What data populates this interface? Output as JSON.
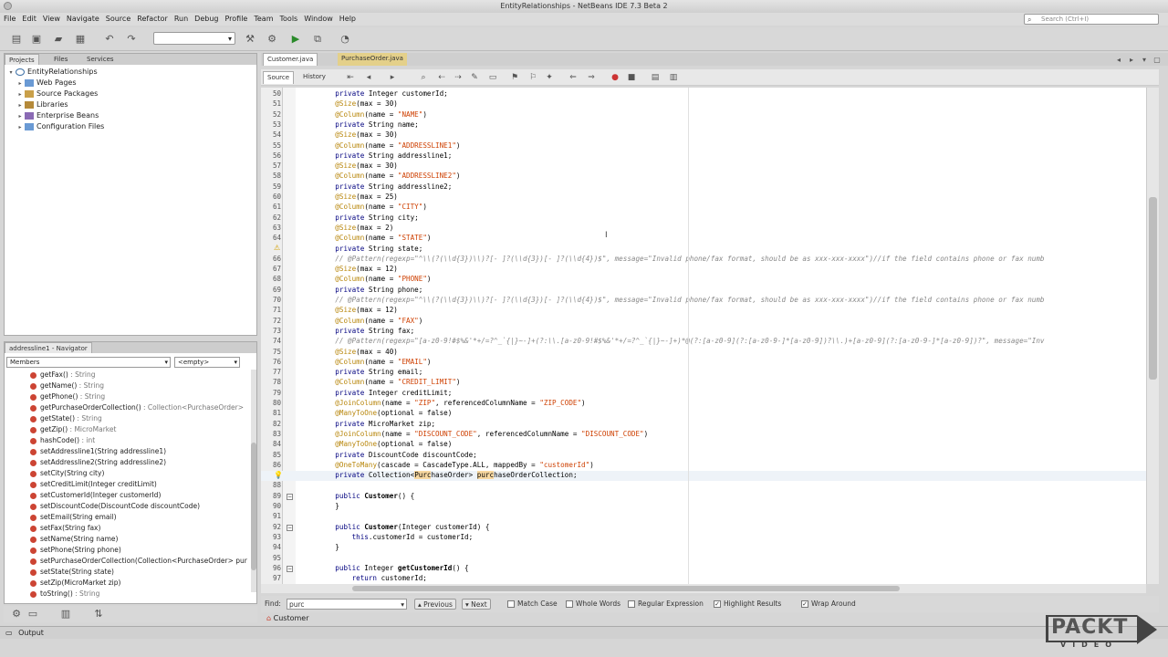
{
  "window": {
    "title": "EntityRelationships - NetBeans IDE 7.3 Beta 2"
  },
  "menu": [
    "File",
    "Edit",
    "View",
    "Navigate",
    "Source",
    "Refactor",
    "Run",
    "Debug",
    "Profile",
    "Team",
    "Tools",
    "Window",
    "Help"
  ],
  "search": {
    "placeholder": "Search (Ctrl+I)"
  },
  "projects": {
    "tabs": [
      "Projects",
      "Files",
      "Services"
    ],
    "root": "EntityRelationships",
    "items": [
      "Web Pages",
      "Source Packages",
      "Libraries",
      "Enterprise Beans",
      "Configuration Files"
    ]
  },
  "navigator": {
    "title": "addressline1 - Navigator",
    "filter": "Members",
    "scope": "<empty>",
    "items": [
      {
        "name": "getFax()",
        "ret": " : String"
      },
      {
        "name": "getName()",
        "ret": " : String"
      },
      {
        "name": "getPhone()",
        "ret": " : String"
      },
      {
        "name": "getPurchaseOrderCollection()",
        "ret": " : Collection<PurchaseOrder>"
      },
      {
        "name": "getState()",
        "ret": " : String"
      },
      {
        "name": "getZip()",
        "ret": " : MicroMarket"
      },
      {
        "name": "hashCode()",
        "ret": " : int"
      },
      {
        "name": "setAddressline1(String addressline1)",
        "ret": ""
      },
      {
        "name": "setAddressline2(String addressline2)",
        "ret": ""
      },
      {
        "name": "setCity(String city)",
        "ret": ""
      },
      {
        "name": "setCreditLimit(Integer creditLimit)",
        "ret": ""
      },
      {
        "name": "setCustomerId(Integer customerId)",
        "ret": ""
      },
      {
        "name": "setDiscountCode(DiscountCode discountCode)",
        "ret": ""
      },
      {
        "name": "setEmail(String email)",
        "ret": ""
      },
      {
        "name": "setFax(String fax)",
        "ret": ""
      },
      {
        "name": "setName(String name)",
        "ret": ""
      },
      {
        "name": "setPhone(String phone)",
        "ret": ""
      },
      {
        "name": "setPurchaseOrderCollection(Collection<PurchaseOrder> pur",
        "ret": ""
      },
      {
        "name": "setState(String state)",
        "ret": ""
      },
      {
        "name": "setZip(MicroMarket zip)",
        "ret": ""
      },
      {
        "name": "toString()",
        "ret": " : String"
      }
    ]
  },
  "editor": {
    "tabs": [
      "Customer.java",
      "PurchaseOrder.java"
    ],
    "modes": [
      "Source",
      "History"
    ],
    "lines": [
      {
        "n": "50",
        "t": "    private Integer customerId;"
      },
      {
        "n": "51",
        "t": "    @Size(max = 30)"
      },
      {
        "n": "52",
        "t": "    @Column(name = \"NAME\")"
      },
      {
        "n": "53",
        "t": "    private String name;"
      },
      {
        "n": "54",
        "t": "    @Size(max = 30)"
      },
      {
        "n": "55",
        "t": "    @Column(name = \"ADDRESSLINE1\")"
      },
      {
        "n": "56",
        "t": "    private String addressline1;"
      },
      {
        "n": "57",
        "t": "    @Size(max = 30)"
      },
      {
        "n": "58",
        "t": "    @Column(name = \"ADDRESSLINE2\")"
      },
      {
        "n": "59",
        "t": "    private String addressline2;"
      },
      {
        "n": "60",
        "t": "    @Size(max = 25)"
      },
      {
        "n": "61",
        "t": "    @Column(name = \"CITY\")"
      },
      {
        "n": "62",
        "t": "    private String city;"
      },
      {
        "n": "63",
        "t": "    @Size(max = 2)"
      },
      {
        "n": "64",
        "t": "    @Column(name = \"STATE\")"
      },
      {
        "n": "",
        "t": "    private String state;"
      },
      {
        "n": "66",
        "t": "    // @Pattern(regexp=\"^\\\\(?(\\\\d{3})\\\\)?[- ]?(\\\\d{3})[- ]?(\\\\d{4})$\", message=\"Invalid phone/fax format, should be as xxx-xxx-xxxx\")//if the field contains phone or fax numb"
      },
      {
        "n": "67",
        "t": "    @Size(max = 12)"
      },
      {
        "n": "68",
        "t": "    @Column(name = \"PHONE\")"
      },
      {
        "n": "69",
        "t": "    private String phone;"
      },
      {
        "n": "70",
        "t": "    // @Pattern(regexp=\"^\\\\(?(\\\\d{3})\\\\)?[- ]?(\\\\d{3})[- ]?(\\\\d{4})$\", message=\"Invalid phone/fax format, should be as xxx-xxx-xxxx\")//if the field contains phone or fax numb"
      },
      {
        "n": "71",
        "t": "    @Size(max = 12)"
      },
      {
        "n": "72",
        "t": "    @Column(name = \"FAX\")"
      },
      {
        "n": "73",
        "t": "    private String fax;"
      },
      {
        "n": "74",
        "t": "    // @Pattern(regexp=\"[a-z0-9!#$%&'*+/=?^_`{|}~-]+(?:\\\\.[a-z0-9!#$%&'*+/=?^_`{|}~-]+)*@(?:[a-z0-9](?:[a-z0-9-]*[a-z0-9])?\\\\.)+[a-z0-9](?:[a-z0-9-]*[a-z0-9])?\", message=\"Inv"
      },
      {
        "n": "75",
        "t": "    @Size(max = 40)"
      },
      {
        "n": "76",
        "t": "    @Column(name = \"EMAIL\")"
      },
      {
        "n": "77",
        "t": "    private String email;"
      },
      {
        "n": "78",
        "t": "    @Column(name = \"CREDIT_LIMIT\")"
      },
      {
        "n": "79",
        "t": "    private Integer creditLimit;"
      },
      {
        "n": "80",
        "t": "    @JoinColumn(name = \"ZIP\", referencedColumnName = \"ZIP_CODE\")"
      },
      {
        "n": "81",
        "t": "    @ManyToOne(optional = false)"
      },
      {
        "n": "82",
        "t": "    private MicroMarket zip;"
      },
      {
        "n": "83",
        "t": "    @JoinColumn(name = \"DISCOUNT_CODE\", referencedColumnName = \"DISCOUNT_CODE\")"
      },
      {
        "n": "84",
        "t": "    @ManyToOne(optional = false)"
      },
      {
        "n": "85",
        "t": "    private DiscountCode discountCode;"
      },
      {
        "n": "86",
        "t": "    @OneToMany(cascade = CascadeType.ALL, mappedBy = \"customerId\")"
      },
      {
        "n": "",
        "t": "    private Collection<PurchaseOrder> purchaseOrderCollection;"
      },
      {
        "n": "88",
        "t": ""
      },
      {
        "n": "89",
        "t": "    public Customer() {"
      },
      {
        "n": "90",
        "t": "    }"
      },
      {
        "n": "91",
        "t": ""
      },
      {
        "n": "92",
        "t": "    public Customer(Integer customerId) {"
      },
      {
        "n": "93",
        "t": "        this.customerId = customerId;"
      },
      {
        "n": "94",
        "t": "    }"
      },
      {
        "n": "95",
        "t": ""
      },
      {
        "n": "96",
        "t": "    public Integer getCustomerId() {"
      },
      {
        "n": "97",
        "t": "        return customerId;"
      }
    ]
  },
  "find": {
    "label": "Find:",
    "value": "purc",
    "previous": "Previous",
    "next": "Next",
    "options": [
      {
        "label": "Match Case",
        "checked": false
      },
      {
        "label": "Whole Words",
        "checked": false
      },
      {
        "label": "Regular Expression",
        "checked": false
      },
      {
        "label": "Highlight Results",
        "checked": true
      },
      {
        "label": "Wrap Around",
        "checked": true
      }
    ]
  },
  "breadcrumb": "Customer",
  "statusbar": {
    "output": "Output"
  },
  "watermark": {
    "word": "PACKT",
    "sub": "VIDEO"
  }
}
